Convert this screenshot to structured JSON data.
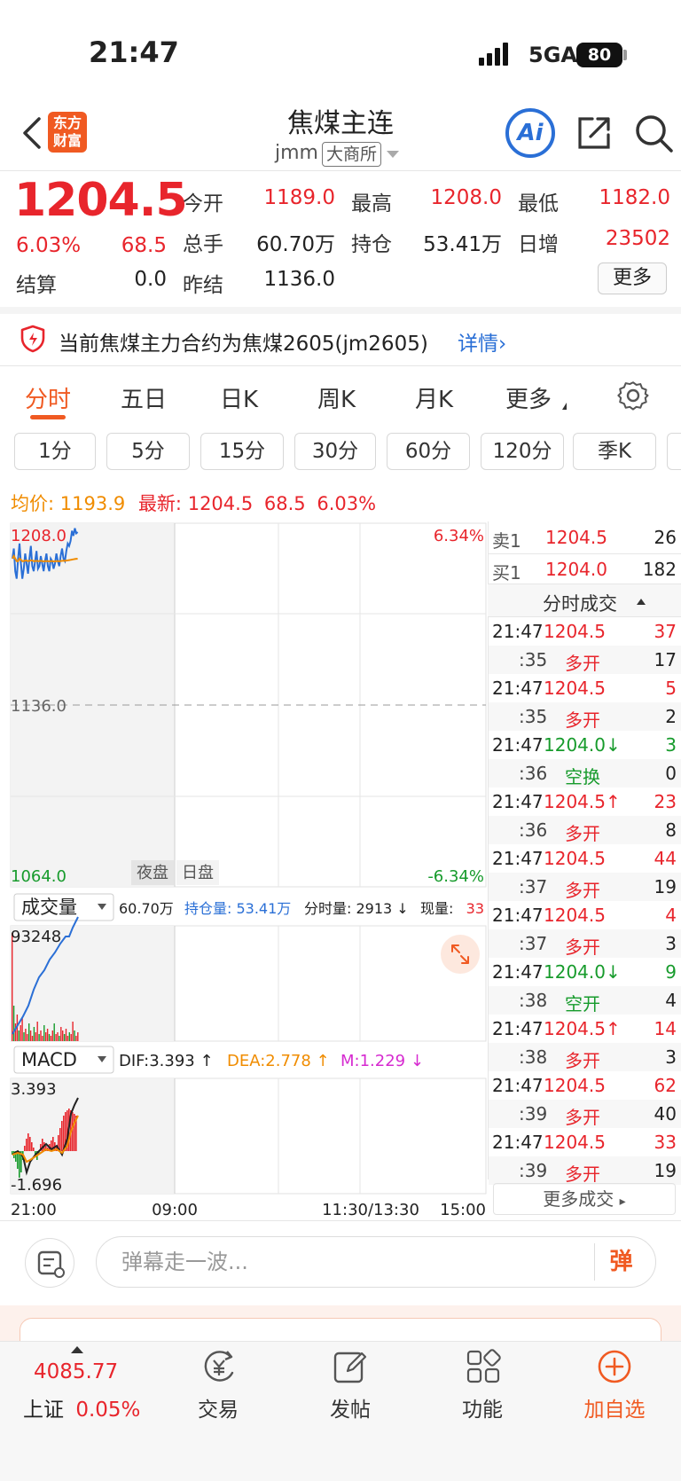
{
  "status": {
    "time": "21:47",
    "network": "5GA",
    "battery": "80"
  },
  "header": {
    "logo": [
      "东方",
      "财富"
    ],
    "title": "焦煤主连",
    "code": "jmm",
    "exchange": "大商所"
  },
  "quote": {
    "price": "1204.5",
    "change_pct": "6.03%",
    "change": "68.5",
    "settle_label": "结算",
    "settle": "0.0",
    "open_label": "今开",
    "open": "1189.0",
    "high_label": "最高",
    "high": "1208.0",
    "low_label": "最低",
    "low": "1182.0",
    "volume_label": "总手",
    "volume": "60.70万",
    "oi_label": "持仓",
    "oi": "53.41万",
    "daily_inc_label": "日增",
    "daily_inc": "23502",
    "prev_settle_label": "昨结",
    "prev_settle": "1136.0",
    "more": "更多"
  },
  "notice": {
    "text": "当前焦煤主力合约为焦煤2605(jm2605)",
    "link": "详情"
  },
  "tabs": [
    "分时",
    "五日",
    "日K",
    "周K",
    "月K",
    "更多"
  ],
  "periods": [
    "1分",
    "5分",
    "15分",
    "30分",
    "60分",
    "120分",
    "季K"
  ],
  "info": {
    "avg_label": "均价:",
    "avg": "1193.9",
    "last_label": "最新:",
    "last": "1204.5",
    "last_change": "68.5",
    "last_pct": "6.03%"
  },
  "chart": {
    "top_price": "1208.0",
    "top_pct": "6.34%",
    "mid_price": "1136.0",
    "bottom_price": "1064.0",
    "bottom_pct": "-6.34%",
    "session_night": "夜盘",
    "session_day": "日盘",
    "x_ticks": [
      "21:00",
      "09:00",
      "11:30/13:30",
      "15:00"
    ],
    "vol_indicator": "成交量",
    "vol_total": "60.70万",
    "vol_oi": "持仓量: 53.41万",
    "vol_tick": "分时量: 2913 ↓",
    "vol_now_label": "现量:",
    "vol_now": "33",
    "vol_max": "93248",
    "macd_indicator": "MACD",
    "macd_dif": "DIF:3.393 ↑",
    "macd_dea": "DEA:2.778 ↑",
    "macd_m": "M:1.229 ↓",
    "macd_top": "3.393",
    "macd_bottom": "-1.696"
  },
  "order_book": {
    "ask_label": "卖1",
    "ask_price": "1204.5",
    "ask_vol": "26",
    "bid_label": "买1",
    "bid_price": "1204.0",
    "bid_vol": "182"
  },
  "trades_title": "分时成交",
  "trades": [
    {
      "time": "21:47",
      "price": "1204.5",
      "pdir": "",
      "vol": "37",
      "sec": ":35",
      "type": "多开",
      "count": "17",
      "color": "red"
    },
    {
      "time": "21:47",
      "price": "1204.5",
      "pdir": "",
      "vol": "5",
      "sec": ":35",
      "type": "多开",
      "count": "2",
      "color": "red"
    },
    {
      "time": "21:47",
      "price": "1204.0",
      "pdir": "↓",
      "vol": "3",
      "sec": ":36",
      "type": "空换",
      "count": "0",
      "color": "green"
    },
    {
      "time": "21:47",
      "price": "1204.5",
      "pdir": "↑",
      "vol": "23",
      "sec": ":36",
      "type": "多开",
      "count": "8",
      "color": "red"
    },
    {
      "time": "21:47",
      "price": "1204.5",
      "pdir": "",
      "vol": "44",
      "sec": ":37",
      "type": "多开",
      "count": "19",
      "color": "red"
    },
    {
      "time": "21:47",
      "price": "1204.5",
      "pdir": "",
      "vol": "4",
      "sec": ":37",
      "type": "多开",
      "count": "3",
      "color": "red"
    },
    {
      "time": "21:47",
      "price": "1204.0",
      "pdir": "↓",
      "vol": "9",
      "sec": ":38",
      "type": "空开",
      "count": "4",
      "color": "green"
    },
    {
      "time": "21:47",
      "price": "1204.5",
      "pdir": "↑",
      "vol": "14",
      "sec": ":38",
      "type": "多开",
      "count": "3",
      "color": "red"
    },
    {
      "time": "21:47",
      "price": "1204.5",
      "pdir": "",
      "vol": "62",
      "sec": ":39",
      "type": "多开",
      "count": "40",
      "color": "red"
    },
    {
      "time": "21:47",
      "price": "1204.5",
      "pdir": "",
      "vol": "33",
      "sec": ":39",
      "type": "多开",
      "count": "19",
      "color": "red"
    }
  ],
  "more_trades": "更多成交",
  "comment": {
    "placeholder": "弹幕走一波...",
    "danmaku": "弹"
  },
  "bottom_nav": {
    "index_value": "4085.77",
    "index_name": "上证",
    "index_pct": "0.05%",
    "trade": "交易",
    "post": "发帖",
    "function": "功能",
    "add_watch": "加自选"
  },
  "chart_data": {
    "type": "line",
    "ylim": [
      1064.0,
      1208.0
    ],
    "reference": 1136.0,
    "x": [
      0,
      1,
      2,
      3,
      4,
      5,
      6,
      7,
      8,
      9,
      10,
      11,
      12,
      13,
      14,
      15,
      16,
      17,
      18,
      19,
      20,
      21,
      22,
      23,
      24,
      25,
      26,
      27,
      28,
      29,
      30,
      31,
      32,
      33,
      34,
      35,
      36,
      37,
      38,
      39,
      40,
      41,
      42,
      43,
      44,
      45,
      46
    ],
    "series": [
      {
        "color": "#2a6fd6",
        "values": [
          1194,
          1198,
          1189,
          1186,
          1194,
          1200,
          1192,
          1186,
          1190,
          1196,
          1192,
          1188,
          1194,
          1199,
          1191,
          1189,
          1193,
          1197,
          1190,
          1191,
          1195,
          1192,
          1189,
          1193,
          1196,
          1191,
          1189,
          1194,
          1193,
          1190,
          1192,
          1196,
          1193,
          1191,
          1195,
          1198,
          1194,
          1193,
          1197,
          1200,
          1199,
          1201,
          1205,
          1203,
          1206,
          1204,
          1204.5
        ]
      },
      {
        "color": "#f08c00",
        "values": [
          1194,
          1195,
          1194,
          1193,
          1193,
          1194,
          1193.5,
          1193,
          1193,
          1193.2,
          1193.2,
          1193,
          1193.1,
          1193.3,
          1193.2,
          1193,
          1193,
          1193.1,
          1193,
          1193,
          1193.1,
          1193,
          1192.9,
          1193,
          1193,
          1193,
          1192.9,
          1193,
          1193,
          1192.9,
          1192.9,
          1193,
          1193,
          1192.9,
          1193,
          1193.1,
          1193.1,
          1193.1,
          1193.2,
          1193.3,
          1193.4,
          1193.5,
          1193.6,
          1193.7,
          1193.8,
          1193.9,
          1193.9
        ]
      }
    ]
  }
}
